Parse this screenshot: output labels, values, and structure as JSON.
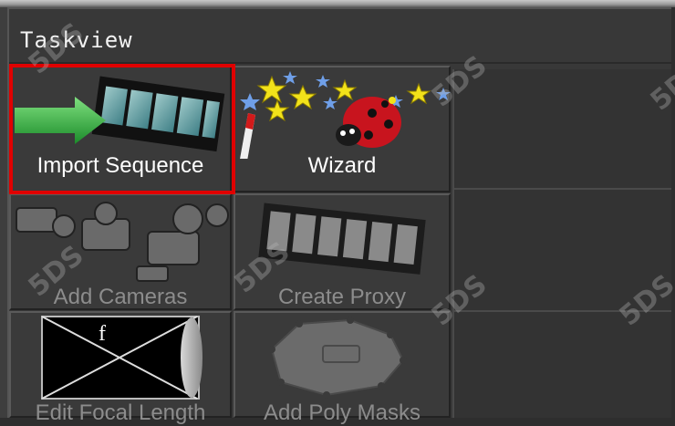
{
  "panel": {
    "title": "Taskview"
  },
  "tiles": [
    {
      "label": "Import Sequence",
      "icon": "import-sequence-icon",
      "enabled": true
    },
    {
      "label": "Wizard",
      "icon": "wizard-icon",
      "enabled": true
    },
    {
      "label": "Add Cameras",
      "icon": "add-cameras-icon",
      "enabled": false
    },
    {
      "label": "Create Proxy",
      "icon": "create-proxy-icon",
      "enabled": false
    },
    {
      "label": "Edit Focal Length",
      "icon": "edit-focal-length-icon",
      "enabled": false,
      "glyph": "f"
    },
    {
      "label": "Add Poly Masks",
      "icon": "add-poly-masks-icon",
      "enabled": false
    }
  ],
  "watermark": "5DS",
  "colors": {
    "highlight": "#e00000",
    "label_enabled": "#ffffff",
    "label_disabled": "#8c8c8c"
  }
}
